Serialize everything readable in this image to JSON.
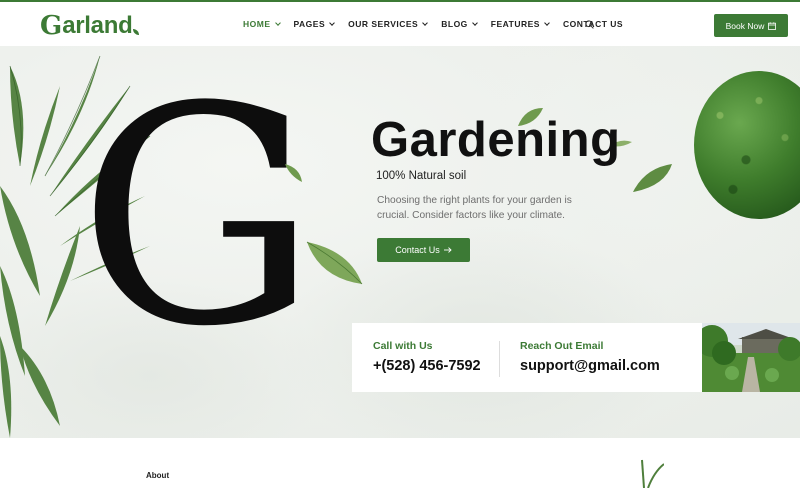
{
  "brand": {
    "logo_initial": "G",
    "logo_rest": "arland"
  },
  "nav": {
    "items": [
      {
        "label": "HOME",
        "dropdown": true,
        "active": true
      },
      {
        "label": "PAGES",
        "dropdown": true,
        "active": false
      },
      {
        "label": "OUR SERVICES",
        "dropdown": true,
        "active": false
      },
      {
        "label": "BLOG",
        "dropdown": true,
        "active": false
      },
      {
        "label": "FEATURES",
        "dropdown": true,
        "active": false
      },
      {
        "label": "CONTACT US",
        "dropdown": false,
        "active": false
      }
    ],
    "search_icon": "search-icon",
    "book_label": "Book Now",
    "book_icon": "calendar-icon"
  },
  "hero": {
    "big_letter": "G",
    "headline": "Gardening",
    "tagline": "100% Natural soil",
    "description": "Choosing the right plants for your garden is crucial. Consider factors like your climate.",
    "cta_label": "Contact Us",
    "cta_icon": "arrow-right-icon"
  },
  "contact": {
    "call_label": "Call with Us",
    "call_value": "+(528) 456-7592",
    "email_label": "Reach Out Email",
    "email_value": "support@gmail.com"
  },
  "about": {
    "label": "About"
  },
  "colors": {
    "accent": "#3c7a35",
    "text": "#111111",
    "muted": "#6e6e6e"
  }
}
